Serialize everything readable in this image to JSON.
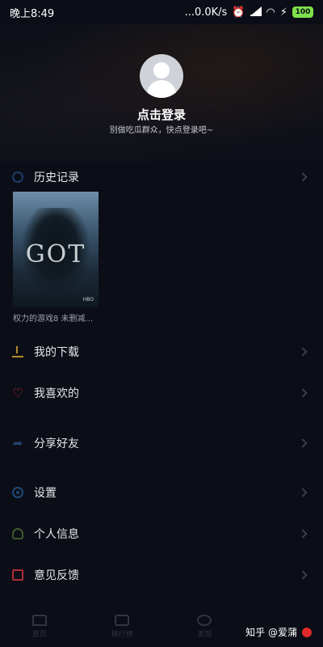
{
  "status": {
    "time": "晚上8:49",
    "speed": "...0.0K/s",
    "battery": "100",
    "colors": {
      "battery": "#7fe04b"
    }
  },
  "profile": {
    "login_title": "点击登录",
    "login_subtitle": "别做吃瓜群众，快点登录吧~"
  },
  "menu": {
    "history": {
      "label": "历史记录",
      "icon": "history-icon"
    },
    "downloads": {
      "label": "我的下载",
      "icon": "download-icon"
    },
    "favorites": {
      "label": "我喜欢的",
      "icon": "heart-icon"
    },
    "share": {
      "label": "分享好友",
      "icon": "share-icon"
    },
    "settings": {
      "label": "设置",
      "icon": "settings-icon"
    },
    "profile": {
      "label": "个人信息",
      "icon": "profile-icon"
    },
    "feedback": {
      "label": "意见反馈",
      "icon": "feedback-icon"
    }
  },
  "history_items": [
    {
      "title": "权力的游戏8 未删减...",
      "poster_text": "GOT",
      "network": "HBO"
    }
  ],
  "tabs": [
    {
      "label": "首页",
      "icon": "home-icon"
    },
    {
      "label": "排行榜",
      "icon": "play-icon"
    },
    {
      "label": "发现",
      "icon": "eye-icon"
    }
  ],
  "watermark": {
    "text": "知乎 @爱蒲"
  }
}
